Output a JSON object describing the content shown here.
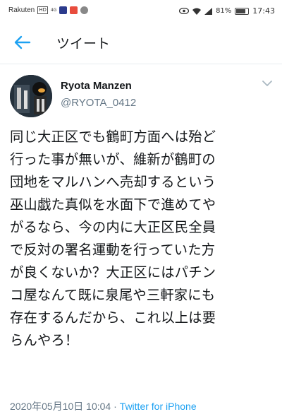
{
  "status_bar": {
    "carrier": "Rakuten",
    "network_badge": "HD",
    "signal_label": "4G",
    "battery": "81%",
    "time": "17:43"
  },
  "header": {
    "title": "ツイート"
  },
  "tweet": {
    "author_name": "Ryota Manzen",
    "author_handle": "@RYOTA_0412",
    "text_lines": [
      "同じ大正区でも鶴町方面へは殆ど",
      "行った事が無いが、維新が鶴町の",
      "団地をマルハンへ売却するという",
      "巫山戯た真似を水面下で進めてや",
      "がるなら、今の内に大正区民全員",
      "で反対の署名運動を行っていた方",
      "が良くないか？大正区にはパチン",
      "コ屋なんて既に泉尾や三軒家にも",
      "存在するんだから、これ以上は要",
      "らんやろ！"
    ],
    "timestamp": "2020年05月10日 10:04",
    "separator": "·",
    "source": "Twitter for iPhone"
  },
  "colors": {
    "accent": "#1da1f2",
    "secondary_text": "#657786",
    "primary_text": "#14171a"
  }
}
